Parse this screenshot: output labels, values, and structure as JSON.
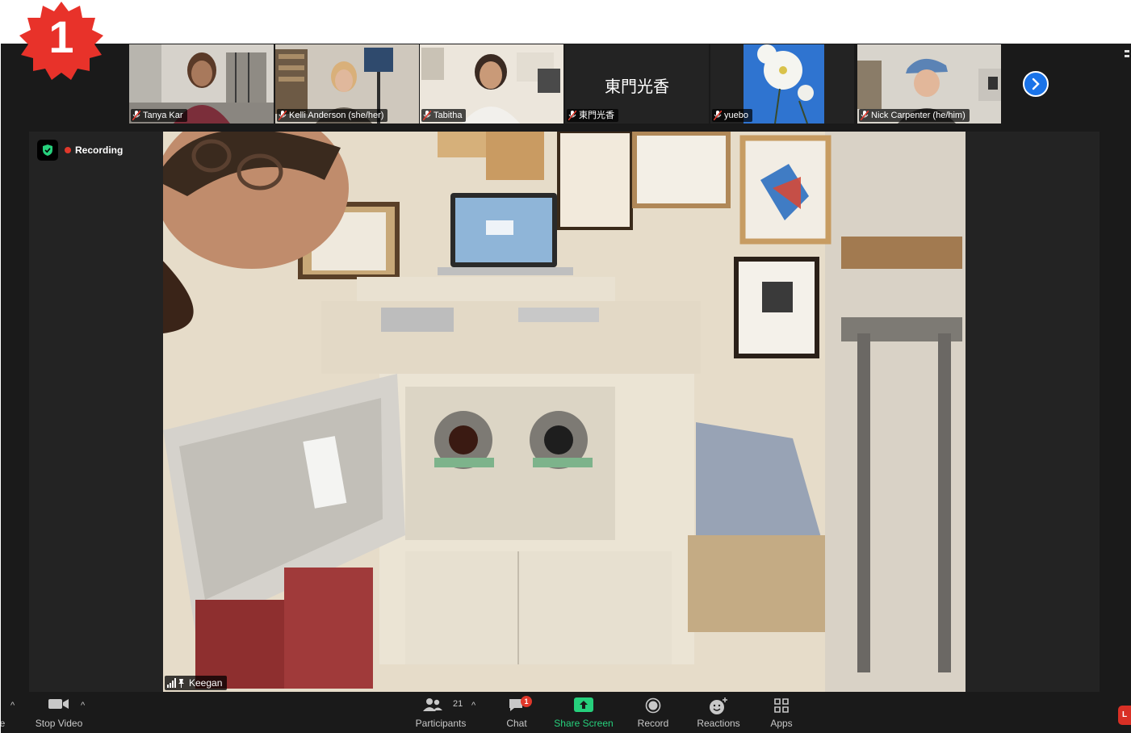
{
  "step": {
    "number": "1",
    "color": "#e8322a"
  },
  "thumbnails": [
    {
      "name": "Tanya Kar",
      "muted": true,
      "scene": "office"
    },
    {
      "name": "Kelli Anderson (she/her)",
      "muted": true,
      "scene": "office"
    },
    {
      "name": "Tabitha",
      "muted": true,
      "scene": "room"
    },
    {
      "name": "東門光香",
      "muted": true,
      "scene": "no-video",
      "display_text": "東門光香"
    },
    {
      "name": "yuebo",
      "muted": true,
      "scene": "flower"
    },
    {
      "name": "Nick Carpenter (he/him)",
      "muted": true,
      "scene": "room"
    }
  ],
  "strip_next_icon": "chevron-right-icon",
  "recording": {
    "label": "Recording",
    "dot_color": "#e0382b",
    "shield_color": "#26d07c"
  },
  "speaker": {
    "name": "Keegan"
  },
  "toolbar": {
    "left_partial": "e",
    "stop_video": "Stop Video",
    "participants": "Participants",
    "participants_count": "21",
    "chat": "Chat",
    "chat_badge": "1",
    "share_screen": "Share Screen",
    "record": "Record",
    "reactions": "Reactions",
    "apps": "Apps",
    "end_partial": "L"
  },
  "colors": {
    "accent_green": "#26d07c",
    "accent_blue": "#1a73e8",
    "danger": "#e0382b"
  }
}
